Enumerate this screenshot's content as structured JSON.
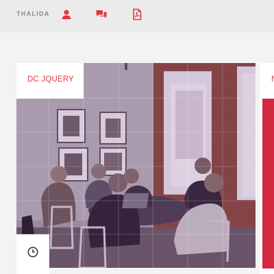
{
  "header": {
    "brand": "THALIDA",
    "icons": [
      "user-icon",
      "chat-icon",
      "pdf-icon"
    ],
    "accent_color": "#e5343f"
  },
  "card": {
    "title": "DC JQUERY",
    "photo_description_icon": "clock-icon"
  },
  "next_card": {
    "title_fragment": "N",
    "accent_color": "#d22a43"
  }
}
